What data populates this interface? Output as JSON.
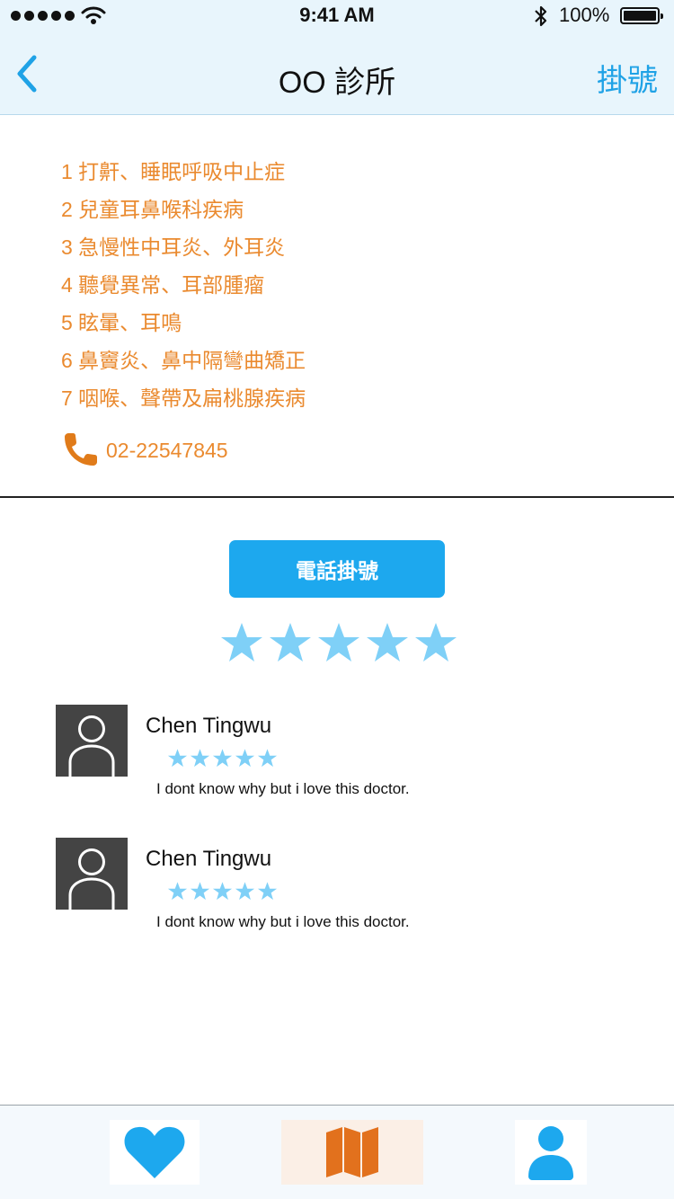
{
  "status_bar": {
    "time": "9:41 AM",
    "battery": "100%"
  },
  "nav": {
    "title": "OO 診所",
    "action_label": "掛號",
    "back_icon": "chevron-left-icon"
  },
  "services": [
    "1 打鼾、睡眠呼吸中止症",
    "2 兒童耳鼻喉科疾病",
    "3 急慢性中耳炎、外耳炎",
    "4 聽覺異常、耳部腫瘤",
    "5 眩暈、耳鳴",
    "6 鼻竇炎、鼻中隔彎曲矯正",
    "7 咽喉、聲帶及扁桃腺疾病"
  ],
  "phone": {
    "number": "02-22547845",
    "icon": "phone-icon"
  },
  "call_button_label": "電話掛號",
  "rating": {
    "stars": 5,
    "max": 5
  },
  "reviews": [
    {
      "name": "Chen Tingwu",
      "stars": 5,
      "text": "I dont know why but i love this doctor."
    },
    {
      "name": "Chen Tingwu",
      "stars": 5,
      "text": "I dont know why but i love this doctor."
    }
  ],
  "tabs": [
    {
      "icon": "heart-icon"
    },
    {
      "icon": "map-icon"
    },
    {
      "icon": "user-icon"
    }
  ],
  "colors": {
    "accent_blue": "#1da8ee",
    "star_blue": "#7fd0f7",
    "orange": "#ea8a2f",
    "map_orange": "#e2711d"
  }
}
